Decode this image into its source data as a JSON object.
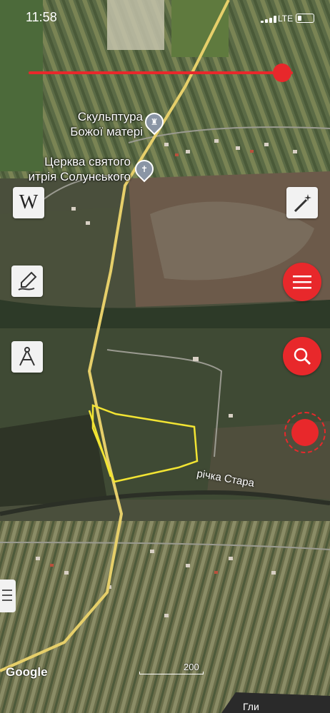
{
  "status_bar": {
    "time": "11:58",
    "network": "LTE"
  },
  "map": {
    "zoom_slider_level": 0.96,
    "pois": [
      {
        "label_line1": "Скульптура",
        "label_line2": "Божої матері",
        "icon": "statue-icon"
      },
      {
        "label_line1": "Церква святого",
        "label_line2": "итрія Солунського",
        "icon": "church-cross-icon"
      }
    ],
    "river_label": "річка Стара",
    "road_label_fragment": "Гли",
    "plot_outline_color": "#f2e433",
    "road_color": "#e6cf6a",
    "scale_label": "200",
    "attribution": "Google"
  },
  "tools": {
    "left": [
      {
        "name": "wikipedia-button",
        "icon": "wikipedia-icon",
        "glyph": "W"
      },
      {
        "name": "draw-button",
        "icon": "pen-drawing-icon"
      },
      {
        "name": "measure-button",
        "icon": "compass-icon"
      }
    ],
    "right": [
      {
        "name": "magic-wand-button",
        "icon": "magic-wand-icon"
      },
      {
        "name": "menu-button",
        "icon": "hamburger-icon"
      },
      {
        "name": "search-button",
        "icon": "search-icon"
      },
      {
        "name": "record-button",
        "icon": "record-icon"
      }
    ]
  },
  "colors": {
    "accent": "#e8282b",
    "tool_bg": "#f2f2f2"
  }
}
